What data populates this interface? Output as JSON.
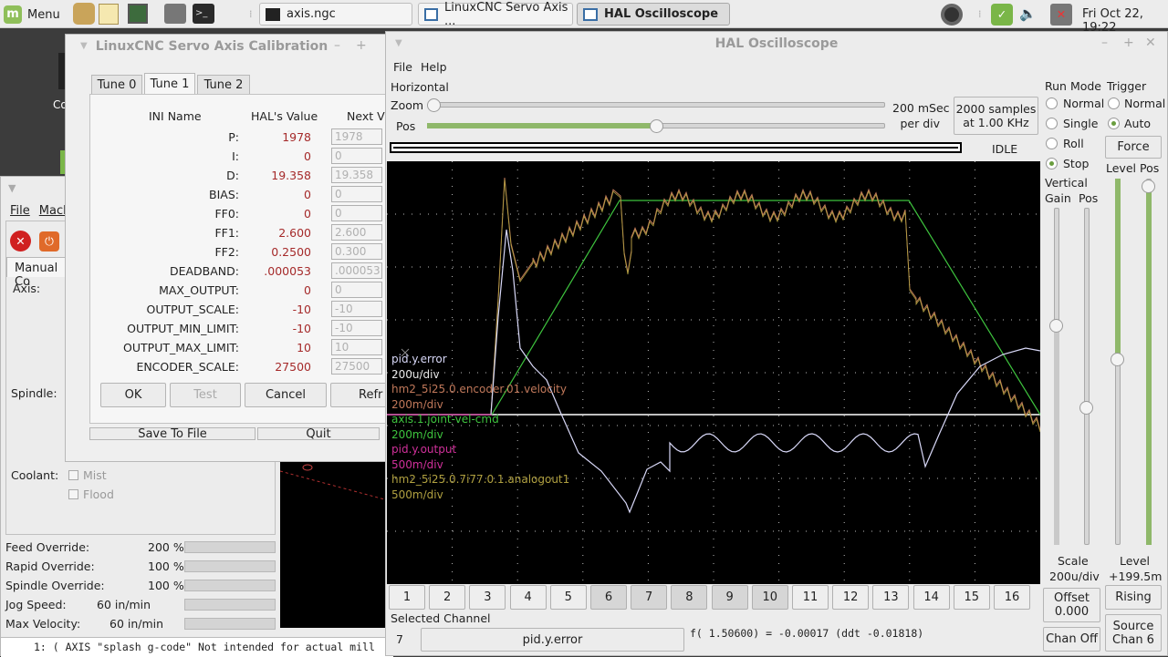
{
  "panel": {
    "menu_label": "Menu",
    "taskbar": [
      {
        "label": "axis.ngc",
        "active": false
      },
      {
        "label": "LinuxCNC Servo Axis ...",
        "active": false
      },
      {
        "label": "HAL Oscilloscope",
        "active": true
      }
    ],
    "clock": "Fri Oct 22, 19:22"
  },
  "axis": {
    "menus": [
      "File",
      "Mach"
    ],
    "tab_label": "Manual Co",
    "axis_label": "Axis:",
    "spindle_label": "Spindle:",
    "coolant_label": "Coolant:",
    "mist_label": "Mist",
    "flood_label": "Flood",
    "overrides": [
      {
        "label": "Feed Override:",
        "value": "200 %"
      },
      {
        "label": "Rapid Override:",
        "value": "100 %"
      },
      {
        "label": "Spindle Override:",
        "value": "100 %"
      },
      {
        "label": "Jog Speed:",
        "value": "60 in/min"
      },
      {
        "label": "Max Velocity:",
        "value": "60 in/min"
      }
    ],
    "gcode_line": "1:  ( AXIS \"splash g-code\" Not intended for actual mill",
    "desktop_label": "Co"
  },
  "calib": {
    "title": "LinuxCNC Servo Axis Calibration",
    "tabs": [
      "Tune 0",
      "Tune 1",
      "Tune 2"
    ],
    "headers": {
      "name": "INI Name",
      "hal": "HAL's Value",
      "next": "Next V"
    },
    "rows": [
      {
        "name": "P:",
        "hal": "1978",
        "next": "1978"
      },
      {
        "name": "I:",
        "hal": "0",
        "next": "0"
      },
      {
        "name": "D:",
        "hal": "19.358",
        "next": "19.358"
      },
      {
        "name": "BIAS:",
        "hal": "0",
        "next": "0"
      },
      {
        "name": "FF0:",
        "hal": "0",
        "next": "0"
      },
      {
        "name": "FF1:",
        "hal": "2.600",
        "next": "2.600"
      },
      {
        "name": "FF2:",
        "hal": "0.2500",
        "next": "0.300"
      },
      {
        "name": "DEADBAND:",
        "hal": ".000053",
        "next": ".000053"
      },
      {
        "name": "MAX_OUTPUT:",
        "hal": "0",
        "next": "0"
      },
      {
        "name": "OUTPUT_SCALE:",
        "hal": "-10",
        "next": "-10"
      },
      {
        "name": "OUTPUT_MIN_LIMIT:",
        "hal": "-10",
        "next": "-10"
      },
      {
        "name": "OUTPUT_MAX_LIMIT:",
        "hal": "10",
        "next": "10"
      },
      {
        "name": "ENCODER_SCALE:",
        "hal": "27500",
        "next": "27500"
      }
    ],
    "buttons": {
      "ok": "OK",
      "test": "Test",
      "cancel": "Cancel",
      "refresh": "Refr",
      "save": "Save To File",
      "quit": "Quit"
    }
  },
  "scope": {
    "title": "HAL Oscilloscope",
    "menus": [
      "File",
      "Help"
    ],
    "horizontal_label": "Horizontal",
    "zoom_label": "Zoom",
    "pos_label": "Pos",
    "msec_line1": "200 mSec",
    "msec_line2": "per div",
    "samples_line1": "2000 samples",
    "samples_line2": "at 1.00 KHz",
    "state": "IDLE",
    "run_mode_label": "Run Mode",
    "run_modes": [
      "Normal",
      "Single",
      "Roll",
      "Stop"
    ],
    "run_mode_selected": "Stop",
    "trigger_label": "Trigger",
    "trigger_modes": [
      "Normal",
      "Auto"
    ],
    "trigger_selected": "Auto",
    "force_label": "Force",
    "vertical_label": "Vertical",
    "gain_label": "Gain",
    "vpos_label": "Pos",
    "level_label": "Level",
    "tpos_label": "Pos",
    "scale_label": "Scale",
    "scale_value": "200u/div",
    "level_value_label": "Level",
    "level_value": "+199.5m",
    "offset_label": "Offset",
    "offset_value": "0.000",
    "rising_label": "Rising",
    "chan_off_label": "Chan Off",
    "source_line1": "Source",
    "source_line2": "Chan 6",
    "channels": [
      "1",
      "2",
      "3",
      "4",
      "5",
      "6",
      "7",
      "8",
      "9",
      "10",
      "11",
      "12",
      "13",
      "14",
      "15",
      "16"
    ],
    "active_channels": [
      "6",
      "7",
      "8",
      "9",
      "10"
    ],
    "selected_channel_label": "Selected Channel",
    "selected_channel_num": "7",
    "selected_channel_name": "pid.y.error",
    "readout": "f( 1.50600) = -0.00017 (ddt -0.01818)",
    "legend": [
      {
        "name": "pid.y.error",
        "scale": "200u/div",
        "color": "#d8d8f8"
      },
      {
        "name": "hm2_5i25.0.encoder.01.velocity",
        "scale": "200m/div",
        "color": "#c0785a"
      },
      {
        "name": "axis.1.joint-vel-cmd",
        "scale": "200m/div",
        "color": "#3ec43e"
      },
      {
        "name": "pid.y.output",
        "scale": "500m/div",
        "color": "#d0309a"
      },
      {
        "name": "hm2_5i25.0.7i77.0.1.analogout1",
        "scale": "500m/div",
        "color": "#b0a040"
      }
    ]
  }
}
